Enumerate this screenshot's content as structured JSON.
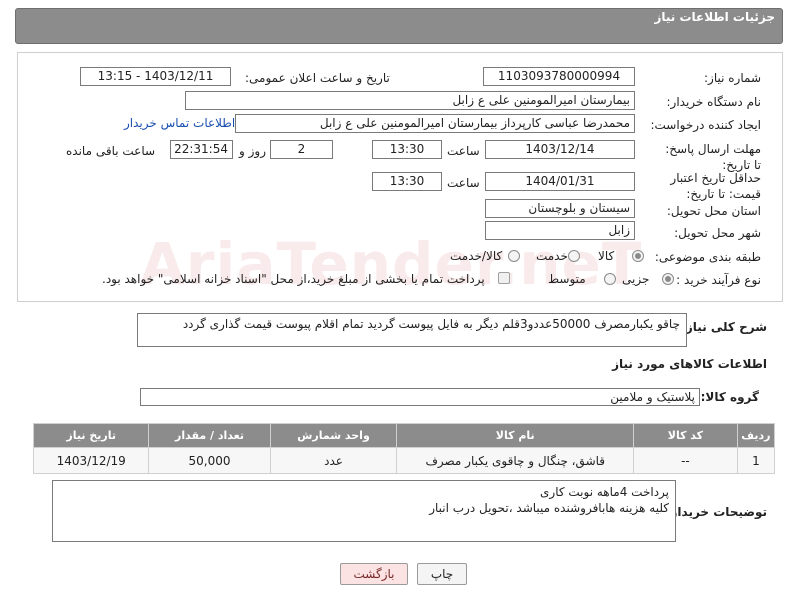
{
  "header": {
    "title": "جزئیات اطلاعات نیاز"
  },
  "fields": {
    "need_number_label": "شماره نیاز:",
    "need_number": "1103093780000994",
    "announce_label": "تاریخ و ساعت اعلان عمومی:",
    "announce_value": "1403/12/11 - 13:15",
    "buyer_org_label": "نام دستگاه خریدار:",
    "buyer_org": "بیمارستان امیرالمومنین علی  ع  زابل",
    "creator_label": "ایجاد کننده درخواست:",
    "creator": "محمدرضا عباسی کارپرداز بیمارستان امیرالمومنین علی  ع  زابل",
    "contact_link": "اطلاعات تماس خریدار",
    "deadline_label": "مهلت ارسال پاسخ: تا تاریخ:",
    "deadline_date": "1403/12/14",
    "time_label": "ساعت",
    "deadline_time": "13:30",
    "days_value": "2",
    "days_label": "روز و",
    "remaining_time": "22:31:54",
    "remaining_label": "ساعت باقی مانده",
    "validity_label": "حداقل تاریخ اعتبار قیمت: تا تاریخ:",
    "validity_date": "1404/01/31",
    "validity_time": "13:30",
    "province_label": "استان محل تحویل:",
    "province": "سیستان و بلوچستان",
    "city_label": "شهر محل تحویل:",
    "city": "زابل",
    "category_label": "طبقه بندی موضوعی:",
    "category_options": [
      "کالا",
      "خدمت",
      "کالا/خدمت"
    ],
    "process_label": "نوع فرآیند خرید :",
    "process_options": [
      "جزیی",
      "متوسط"
    ],
    "payment_note": "پرداخت تمام یا بخشی از مبلغ خرید،از محل \"اسناد خزانه اسلامی\" خواهد بود."
  },
  "description": {
    "label": "شرح کلی نیاز:",
    "text": "چاقو یکبارمصرف 50000عددو3قلم دیگر به فایل پیوست گردید تمام اقلام پیوست قیمت گذاری گردد"
  },
  "goods_info": {
    "title": "اطلاعات کالاهای مورد نیاز",
    "group_label": "گروه کالا:",
    "group_value": "پلاستیک و ملامین"
  },
  "table": {
    "headers": [
      "ردیف",
      "کد کالا",
      "نام کالا",
      "واحد شمارش",
      "تعداد / مقدار",
      "تاریخ نیاز"
    ],
    "rows": [
      [
        "1",
        "--",
        "قاشق، چنگال و چاقوی یکبار مصرف",
        "عدد",
        "50,000",
        "1403/12/19"
      ]
    ]
  },
  "buyer_notes": {
    "label": "توضیحات خریدار:",
    "line1": "پرداخت 4ماهه نوبت کاری",
    "line2": "کلیه هزینه هابافروشنده میباشد ،تحویل درب انبار"
  },
  "buttons": {
    "print": "چاپ",
    "back": "بازگشت"
  },
  "watermark": "AriaTender.neT"
}
